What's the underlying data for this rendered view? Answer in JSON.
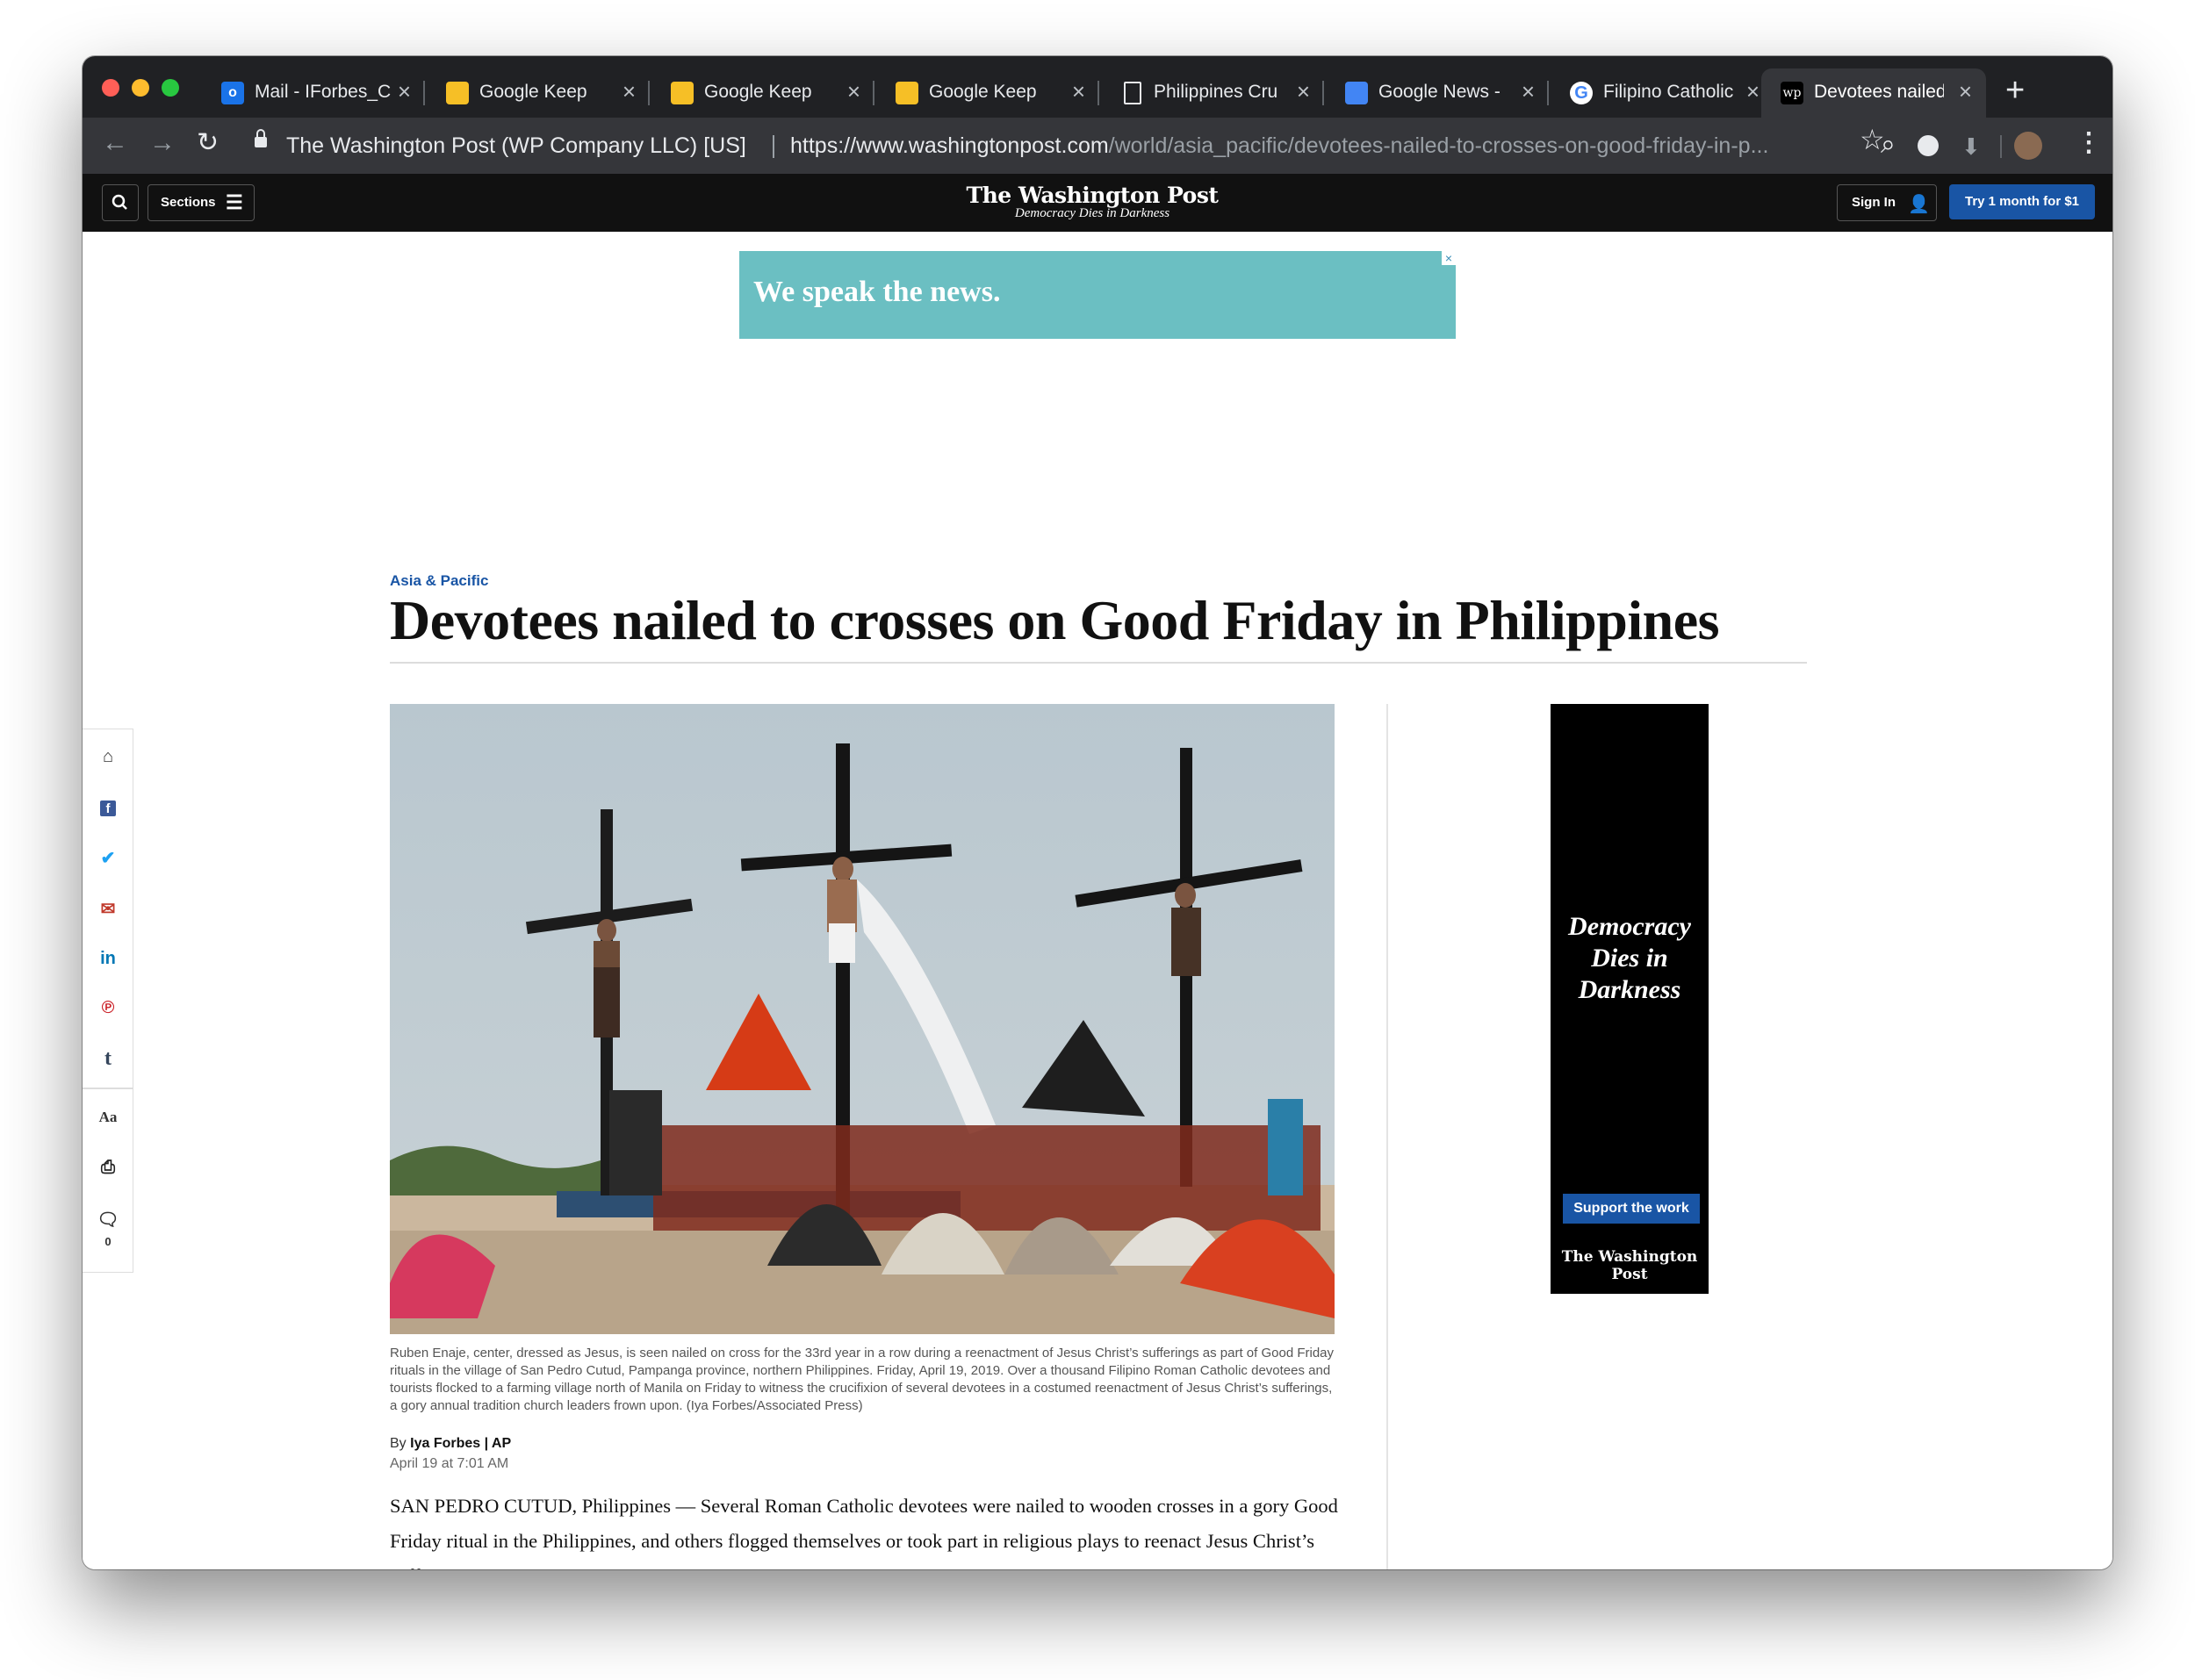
{
  "browser": {
    "tabs": [
      {
        "title": "Mail - IForbes_C",
        "favicon": "outlook-icon",
        "color": "#1a73e8"
      },
      {
        "title": "Google Keep",
        "favicon": "keep-icon",
        "color": "#f6bf26"
      },
      {
        "title": "Google Keep",
        "favicon": "keep-icon",
        "color": "#f6bf26"
      },
      {
        "title": "Google Keep",
        "favicon": "keep-icon",
        "color": "#f6bf26"
      },
      {
        "title": "Philippines Cru",
        "favicon": "document-icon",
        "color": "#e8eaed"
      },
      {
        "title": "Google News -",
        "favicon": "news-icon",
        "color": "#4285f4"
      },
      {
        "title": "Filipino Catholic",
        "favicon": "google-icon",
        "color": "#ffffff"
      },
      {
        "title": "Devotees nailed",
        "favicon": "wapo-icon",
        "color": "#ffffff",
        "active": true
      }
    ],
    "new_tab": "+",
    "site_identity": "The Washington Post (WP Company LLC) [US]",
    "url_host": "https://www.washingtonpost.com",
    "url_path": "/world/asia_pacific/devotees-nailed-to-crosses-on-good-friday-in-p..."
  },
  "header": {
    "sections_label": "Sections",
    "masthead": "The Washington Post",
    "tagline": "Democracy Dies in Darkness",
    "sign_in": "Sign In",
    "trial": "Try 1 month for $1"
  },
  "ad_top": {
    "text": "We speak the news.",
    "close": "×",
    "color": "#6bbfc2"
  },
  "article": {
    "section": "Asia & Pacific",
    "headline": "Devotees nailed to crosses on Good Friday in Philippines",
    "caption": "Ruben Enaje, center, dressed as Jesus, is seen nailed on cross for the 33rd year in a row during a reenactment of Jesus Christ’s sufferings as part of Good Friday rituals in the village of San Pedro Cutud, Pampanga province, northern Philippines. Friday, April 19, 2019. Over a thousand Filipino Roman Catholic devotees and tourists flocked to a farming village north of Manila on Friday to witness the crucifixion of several devotees in a costumed reenactment of Jesus Christ’s sufferings, a gory annual tradition church leaders frown upon. (Iya Forbes/Associated Press)",
    "by_prefix": "By",
    "author": "Iya Forbes | AP",
    "date": "April 19 at 7:01 AM",
    "body": "SAN PEDRO CUTUD, Philippines — Several Roman Catholic devotees were nailed to wooden crosses in a gory Good Friday ritual in the Philippines, and others flogged themselves or took part in religious plays to reenact Jesus Christ’s suffering."
  },
  "share_rail": {
    "comment_count": "0",
    "icons": [
      "home-icon",
      "facebook-icon",
      "twitter-icon",
      "email-icon",
      "linkedin-icon",
      "pinterest-icon",
      "tumblr-icon",
      "text-size-icon",
      "print-icon",
      "comment-icon"
    ]
  },
  "ad_side": {
    "slogan": "Democracy Dies in Darkness",
    "cta": "Support the work",
    "logo": "The Washington Post"
  },
  "colors": {
    "accent": "#1955a5",
    "header_bg": "#111111",
    "tab_bg": "#202124",
    "toolbar_bg": "#35363a"
  }
}
